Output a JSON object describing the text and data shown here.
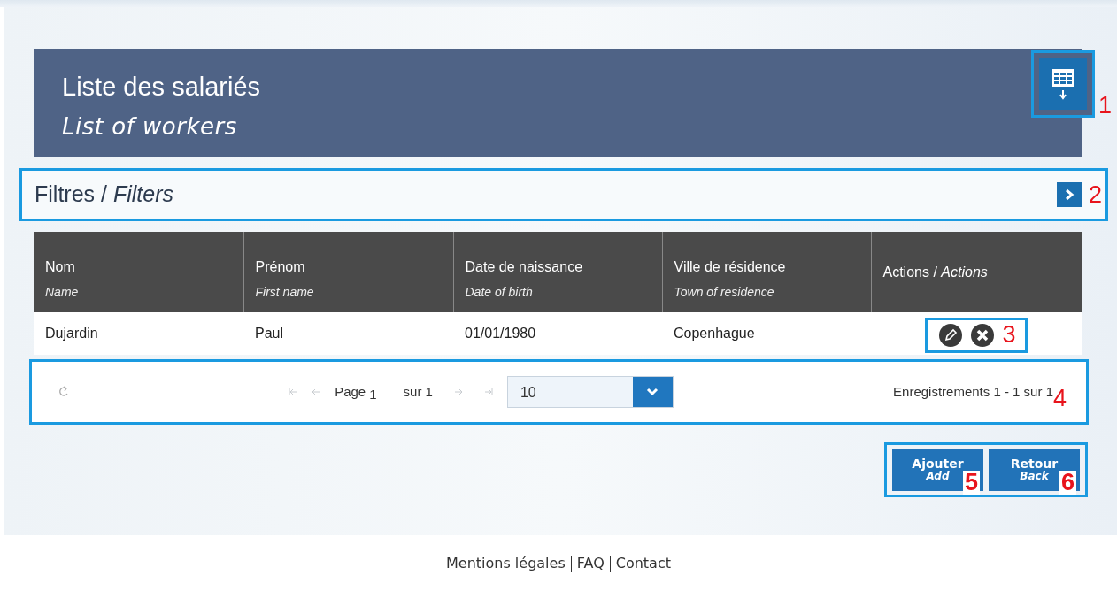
{
  "header": {
    "title": "Liste des salariés",
    "subtitle": "List of workers",
    "export_button": {
      "callout": "1"
    }
  },
  "filters": {
    "label": "Filtres / *Filters*",
    "expanded": false,
    "callout": "2"
  },
  "table": {
    "columns": [
      {
        "label": "Nom",
        "label_en": "Name"
      },
      {
        "label": "Prénom",
        "label_en": "First name"
      },
      {
        "label": "Date de naissance",
        "label_en": "Date of birth"
      },
      {
        "label": "Ville de résidence",
        "label_en": "Town of residence"
      },
      {
        "label": "Actions / *Actions*",
        "kind": "actions"
      }
    ],
    "rows": [
      {
        "cells": [
          "Dujardin",
          "Paul",
          "01/01/1980",
          "Copenhague"
        ],
        "actions_callout": "3"
      }
    ]
  },
  "pager": {
    "page_label": "Page",
    "page": "1",
    "of_label": "sur 1",
    "page_size": "10",
    "records": "Enregistrements 1 - 1 sur 1",
    "callout": "4"
  },
  "buttons": [
    {
      "label": "Ajouter",
      "label_en": "Add",
      "callout": "5"
    },
    {
      "label": "Retour",
      "label_en": "Back",
      "callout": "6"
    }
  ],
  "footer": {
    "links": [
      "Mentions légales",
      "FAQ",
      "Contact"
    ]
  }
}
